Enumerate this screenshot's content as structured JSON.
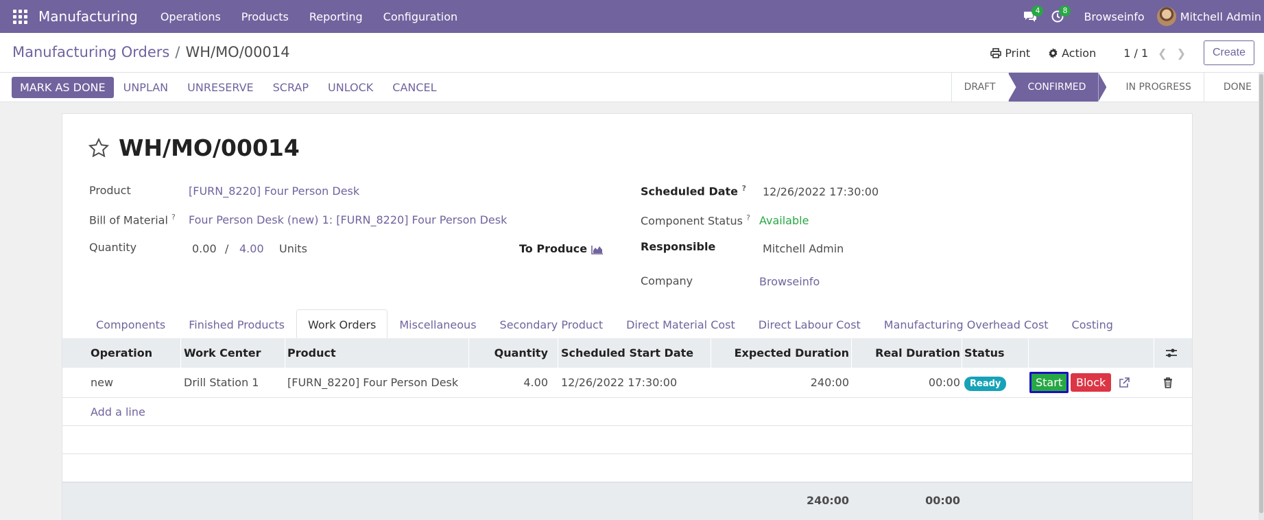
{
  "navbar": {
    "app_name": "Manufacturing",
    "menus": [
      "Operations",
      "Products",
      "Reporting",
      "Configuration"
    ],
    "messages_count": "4",
    "activities_count": "8",
    "company": "Browseinfo",
    "user": "Mitchell Admin"
  },
  "control_panel": {
    "breadcrumb_parent": "Manufacturing Orders",
    "breadcrumb_separator": "/",
    "breadcrumb_current": "WH/MO/00014",
    "print_label": "Print",
    "action_label": "Action",
    "pager": "1 / 1",
    "create_label": "Create"
  },
  "statusbar": {
    "buttons": {
      "mark_as_done": "MARK AS DONE",
      "unplan": "UNPLAN",
      "unreserve": "UNRESERVE",
      "scrap": "SCRAP",
      "unlock": "UNLOCK",
      "cancel": "CANCEL"
    },
    "stages": [
      "DRAFT",
      "CONFIRMED",
      "IN PROGRESS",
      "DONE"
    ],
    "active_stage": "CONFIRMED"
  },
  "form": {
    "title": "WH/MO/00014",
    "product_label": "Product",
    "product_value": "[FURN_8220] Four Person Desk",
    "bom_label": "Bill of Material",
    "bom_value": "Four Person Desk (new) 1: [FURN_8220] Four Person Desk",
    "quantity_label": "Quantity",
    "quantity_produced": "0.00",
    "quantity_sep": "/",
    "quantity_total": "4.00",
    "quantity_uom": "Units",
    "to_produce_label": "To Produce",
    "scheduled_date_label": "Scheduled Date",
    "scheduled_date_value": "12/26/2022 17:30:00",
    "component_status_label": "Component Status",
    "component_status_value": "Available",
    "responsible_label": "Responsible",
    "responsible_value": "Mitchell Admin",
    "company_label": "Company",
    "company_value": "Browseinfo",
    "help_mark": "?"
  },
  "tabs": [
    "Components",
    "Finished Products",
    "Work Orders",
    "Miscellaneous",
    "Secondary Product",
    "Direct Material Cost",
    "Direct Labour Cost",
    "Manufacturing Overhead Cost",
    "Costing"
  ],
  "active_tab": "Work Orders",
  "work_orders": {
    "columns": {
      "operation": "Operation",
      "work_center": "Work Center",
      "product": "Product",
      "quantity": "Quantity",
      "scheduled_start": "Scheduled Start Date",
      "expected_duration": "Expected Duration",
      "real_duration": "Real Duration",
      "status": "Status"
    },
    "rows": [
      {
        "operation": "new",
        "work_center": "Drill Station 1",
        "product": "[FURN_8220] Four Person Desk",
        "quantity": "4.00",
        "scheduled_start": "12/26/2022 17:30:00",
        "expected_duration": "240:00",
        "real_duration": "00:00",
        "status": "Ready",
        "start_label": "Start",
        "block_label": "Block"
      }
    ],
    "add_line": "Add a line",
    "totals": {
      "expected_duration": "240:00",
      "real_duration": "00:00"
    }
  }
}
